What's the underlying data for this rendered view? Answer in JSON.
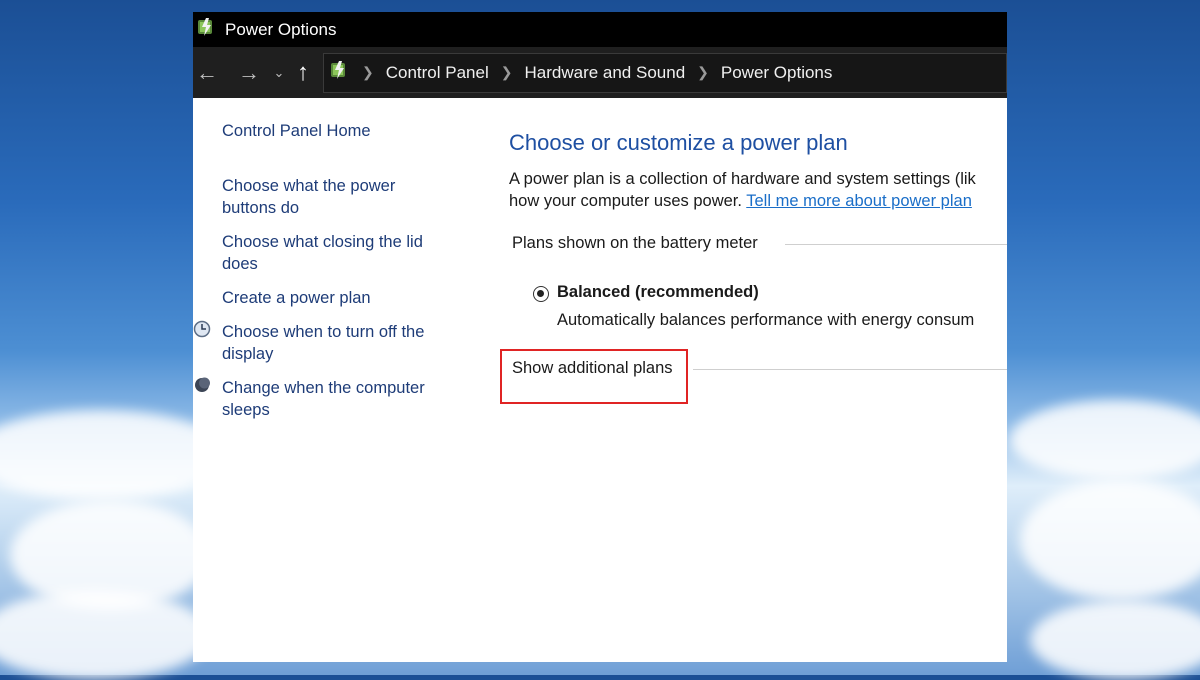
{
  "window": {
    "title": "Power Options",
    "icon": "power-options-icon"
  },
  "address": {
    "back_icon": "back-arrow-icon",
    "forward_icon": "forward-arrow-icon",
    "recent_icon": "chevron-down-icon",
    "up_icon": "up-arrow-icon",
    "crumbs": [
      "Control Panel",
      "Hardware and Sound",
      "Power Options"
    ]
  },
  "sidebar": {
    "home": "Control Panel Home",
    "items": [
      {
        "line1": "Choose what the power",
        "line2": "buttons do"
      },
      {
        "line1": "Choose what closing the lid",
        "line2": "does"
      },
      {
        "line1": "Create a power plan",
        "line2": ""
      },
      {
        "line1": "Choose when to turn off the",
        "line2": "display",
        "icon": "clock-icon"
      },
      {
        "line1": "Change when the computer",
        "line2": "sleeps",
        "icon": "moon-icon"
      }
    ]
  },
  "main": {
    "heading": "Choose or customize a power plan",
    "desc_line1": "A power plan is a collection of hardware and system settings (lik",
    "desc_line2_text": "how your computer uses power. ",
    "desc_link": "Tell me more about power plan",
    "group_label": "Plans shown on the battery meter",
    "plan_name": "Balanced (recommended)",
    "plan_desc": "Automatically balances performance with energy consum",
    "show_more": "Show additional plans"
  },
  "colors": {
    "highlight": "#e02424",
    "link": "#1e3c78",
    "heading": "#1e4fa2"
  }
}
